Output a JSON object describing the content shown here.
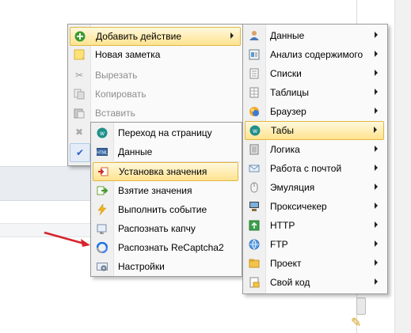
{
  "main_menu": {
    "items": [
      {
        "label": "Добавить действие",
        "icon": "green-plus-icon",
        "disabled": false
      },
      {
        "label": "Новая заметка",
        "icon": "sticky-note-icon",
        "disabled": false
      },
      {
        "label": "Вырезать",
        "icon": "scissors-icon",
        "disabled": true
      },
      {
        "label": "Копировать",
        "icon": "copy-icon",
        "disabled": true
      },
      {
        "label": "Вставить",
        "icon": "paste-icon",
        "disabled": true
      }
    ]
  },
  "actions_menu": {
    "items": [
      {
        "label": "Переход на страницу",
        "icon": "tab-w-icon"
      },
      {
        "label": "Данные",
        "icon": "html-icon"
      },
      {
        "label": "Установка значения",
        "icon": "set-value-icon"
      },
      {
        "label": "Взятие значения",
        "icon": "get-value-icon"
      },
      {
        "label": "Выполнить событие",
        "icon": "lightning-icon"
      },
      {
        "label": "Распознать капчу",
        "icon": "captcha-icon"
      },
      {
        "label": "Распознать ReCaptcha2",
        "icon": "recaptcha-icon"
      },
      {
        "label": "Настройки",
        "icon": "gear-icon"
      }
    ]
  },
  "categories_menu": {
    "items": [
      {
        "label": "Данные",
        "icon": "user-icon"
      },
      {
        "label": "Анализ содержимого",
        "icon": "document-analysis-icon"
      },
      {
        "label": "Списки",
        "icon": "list-icon"
      },
      {
        "label": "Таблицы",
        "icon": "table-icon"
      },
      {
        "label": "Браузер",
        "icon": "browser-icon"
      },
      {
        "label": "Табы",
        "icon": "tab-w-icon"
      },
      {
        "label": "Логика",
        "icon": "logic-icon"
      },
      {
        "label": "Работа с почтой",
        "icon": "envelope-icon"
      },
      {
        "label": "Эмуляция",
        "icon": "mouse-icon"
      },
      {
        "label": "Проксичекер",
        "icon": "computer-icon"
      },
      {
        "label": "HTTP",
        "icon": "http-icon"
      },
      {
        "label": "FTP",
        "icon": "ftp-icon"
      },
      {
        "label": "Проект",
        "icon": "project-icon"
      },
      {
        "label": "Свой код",
        "icon": "code-icon"
      }
    ]
  },
  "colors": {
    "highlight_top": "#fff9dd",
    "highlight_bottom": "#ffe38f",
    "highlight_border": "#e1b743",
    "arrow_red": "#d6242a"
  }
}
